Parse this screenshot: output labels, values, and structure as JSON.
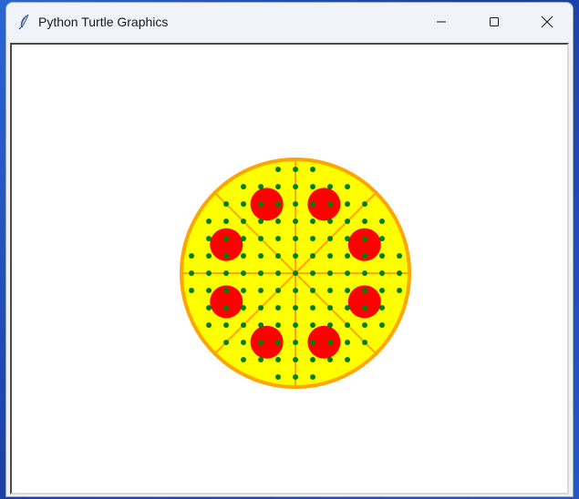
{
  "window": {
    "title": "Python Turtle Graphics"
  },
  "icons": {
    "app": "feather-icon",
    "minimize": "minimize-icon",
    "maximize": "maximize-icon",
    "close": "close-icon"
  },
  "drawing": {
    "subject": "pizza",
    "slices": 8,
    "pepperoni_count": 8,
    "colors": {
      "crust": "#ffa500",
      "cheese": "#ffff00",
      "pepperoni": "#ff0000",
      "herbs": "#008000",
      "background": "#ffffff"
    }
  }
}
